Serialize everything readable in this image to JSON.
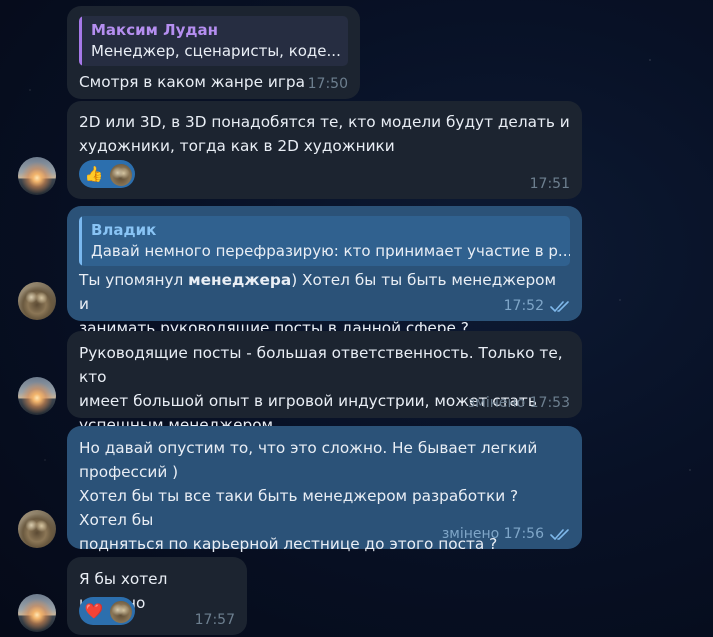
{
  "messages": [
    {
      "reply_name": "Максим Лудан",
      "reply_text": "Менеджер, сценаристы, коде...",
      "text": "Смотря в каком жанре игра",
      "time": "17:50"
    },
    {
      "text_line1": "2D или 3D, в 3D понадобятся те, кто модели будут делать и",
      "text_line2": "художники, тогда как в 2D художники",
      "reaction": "👍",
      "reaction_icon": "thumbs-up-icon",
      "time": "17:51"
    },
    {
      "reply_name": "Владик",
      "reply_text": "Давай немного перефразирую: кто принимает участие в р...",
      "text_part1": "Ты упомянул ",
      "text_bold": "менеджера",
      "text_part2": ") Хотел бы ты быть менеджером и",
      "text_line2": "занимать руководящие посты в данной сфере ?",
      "time": "17:52"
    },
    {
      "text_line1": "Руководящие посты - большая ответственность. Только те, кто",
      "text_line2": "имеет большой опыт в игровой индустрии, может стать",
      "text_line3": "успешным менеджером",
      "time": "змінено 17:53"
    },
    {
      "text_line1": "Но давай опустим то, что это сложно. Не бывает легкий",
      "text_line2": "профессий )",
      "text_line3": "Хотел бы ты все таки быть менеджером разработки ? Хотел бы",
      "text_line4": "подняться по карьерной лестнице до этого поста ?",
      "time": "змінено 17:56"
    },
    {
      "text": "Я бы хотел конечно",
      "reaction": "❤️",
      "reaction_icon": "heart-icon",
      "time": "17:57"
    }
  ],
  "colors": {
    "incoming_bubble": "#1c2430",
    "outgoing_bubble": "#2b5278",
    "reaction_pill": "#2c6fae"
  }
}
